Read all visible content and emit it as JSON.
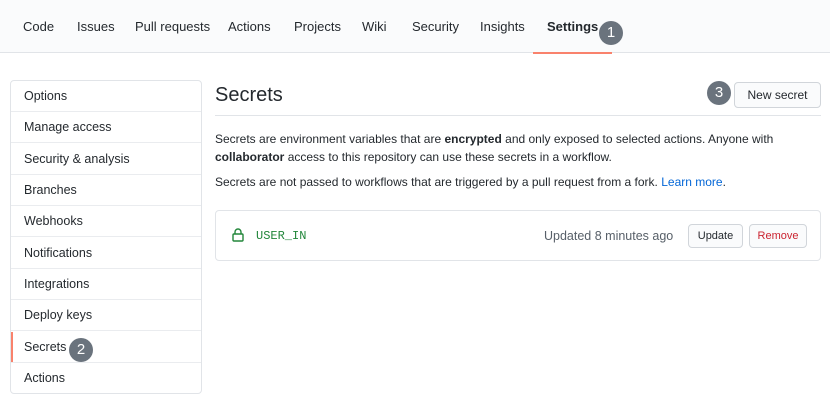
{
  "nav": {
    "tabs": [
      {
        "label": "Code"
      },
      {
        "label": "Issues"
      },
      {
        "label": "Pull requests"
      },
      {
        "label": "Actions"
      },
      {
        "label": "Projects"
      },
      {
        "label": "Wiki"
      },
      {
        "label": "Security"
      },
      {
        "label": "Insights"
      },
      {
        "label": "Settings",
        "selected": true
      }
    ]
  },
  "markers": [
    "1",
    "2",
    "3"
  ],
  "menu": {
    "items": [
      {
        "label": "Options"
      },
      {
        "label": "Manage access"
      },
      {
        "label": "Security & analysis"
      },
      {
        "label": "Branches"
      },
      {
        "label": "Webhooks"
      },
      {
        "label": "Notifications"
      },
      {
        "label": "Integrations"
      },
      {
        "label": "Deploy keys"
      },
      {
        "label": "Secrets",
        "active": true
      },
      {
        "label": "Actions"
      }
    ]
  },
  "main": {
    "title": "Secrets",
    "new_secret_label": "New secret",
    "desc1_a": "Secrets are environment variables that are ",
    "desc1_b": "encrypted",
    "desc1_c": " and only exposed to selected actions. Anyone with ",
    "desc1_d": "collaborator",
    "desc1_e": " access to this repository can use these secrets in a workflow.",
    "desc2": "Secrets are not passed to workflows that are triggered by a pull request from a fork. ",
    "learn_more": "Learn more",
    "learn_more_suffix": ".",
    "secret": {
      "name": "USER_IN",
      "updated": "Updated 8 minutes ago",
      "update_label": "Update",
      "remove_label": "Remove"
    }
  },
  "colors": {
    "accent_underline": "#f9826c",
    "link": "#0366d6",
    "secret_name": "#22863a",
    "danger": "#cb2431",
    "marker": "#6a737d"
  },
  "icons": {
    "secret_lock": "lock-icon"
  }
}
